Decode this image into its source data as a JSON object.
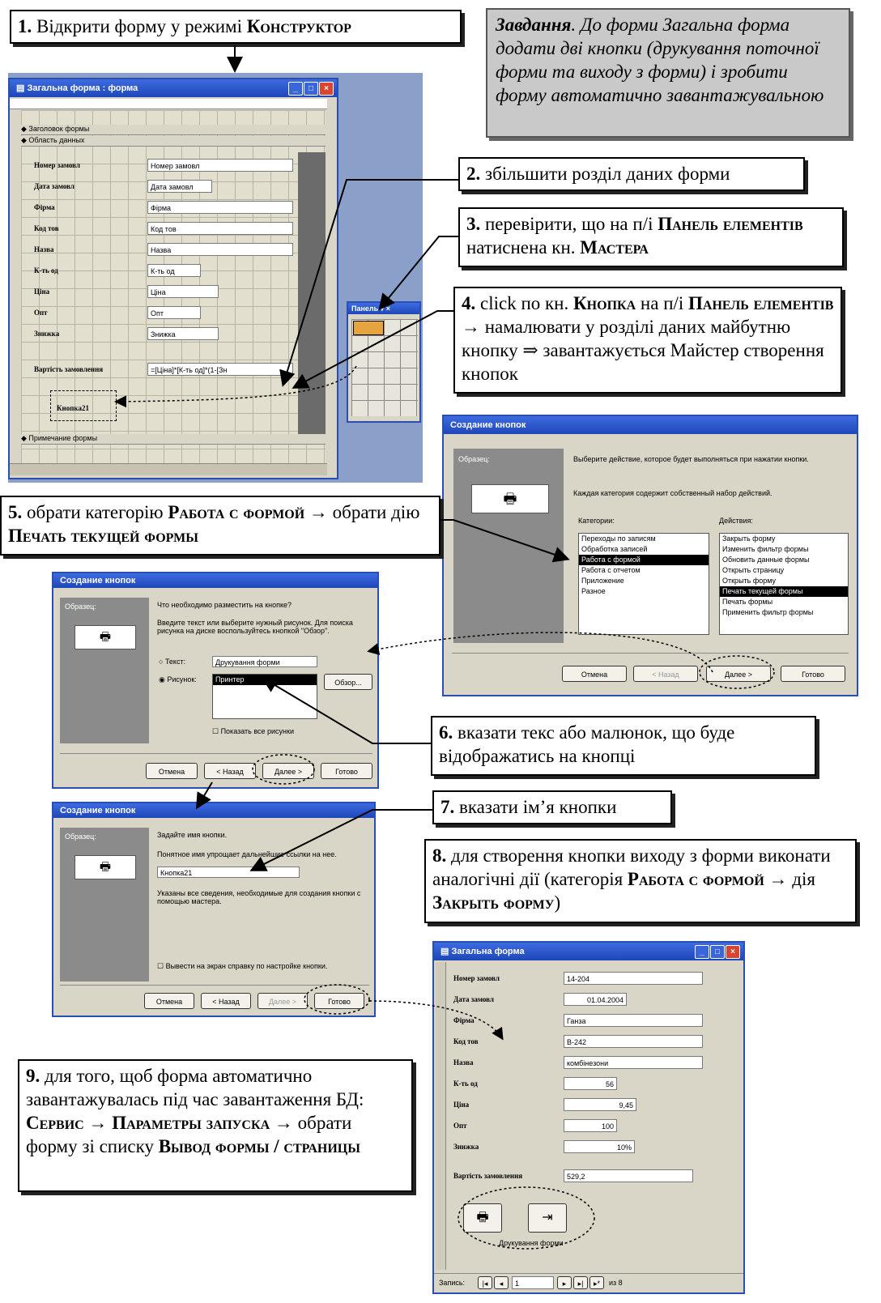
{
  "callouts": {
    "c1": {
      "num": "1.",
      "text": "Відкрити форму у режимі ",
      "bold": "Конструктор"
    },
    "task": {
      "lead": "Завдання",
      "text": ". До форми Загальна форма додати дві кнопки (друкування поточної форми та виходу з форми) і зробити форму автоматично завантажувальною"
    },
    "c2": {
      "num": "2.",
      "text": "збільшити розділ даних форми"
    },
    "c3": {
      "num": "3.",
      "text": "перевірити, що на п/і ",
      "b1": "Панель елементів",
      "t2": " натиснена кн. ",
      "b2": "Мастера"
    },
    "c4": {
      "num": "4.",
      "t1": "click по кн. ",
      "b1": "Кнопка",
      "t2": " на п/і ",
      "b2": "Панель елементів",
      "t3": " → намалювати у розділі даних майбутню кнопку ⇒ завантажується Майстер створення кнопок"
    },
    "c5": {
      "num": "5.",
      "t1": "обрати категорію ",
      "b1": "Работа с формой",
      "t2": " → обрати дію ",
      "b2": "Печать текущей формы"
    },
    "c6": {
      "num": "6.",
      "text": "вказати текс або малюнок, що буде відображатись на кнопці"
    },
    "c7": {
      "num": "7.",
      "text": "вказати ім’я кнопки"
    },
    "c8": {
      "num": "8.",
      "t1": "для створення кнопки виходу з форми виконати аналогічні дії (категорія ",
      "b1": "Работа с формой",
      "t2": " → дія ",
      "b2": "Закрыть форму",
      "t3": ")"
    },
    "c9": {
      "num": "9.",
      "t1": "для того, щоб форма автоматично завантажувалась під час завантаження БД: ",
      "b1": "Сервис → Параметры запуска",
      "t2": " → обрати форму зі списку ",
      "b2": "Вывод формы / страницы"
    }
  },
  "designer": {
    "title": "Загальна форма : форма",
    "header_section": "Заголовок формы",
    "data_section": "Область данных",
    "footer_section": "Примечание формы",
    "rows": [
      {
        "label": "Номер замовл",
        "field": "Номер замовл"
      },
      {
        "label": "Дата замовл",
        "field": "Дата замовл"
      },
      {
        "label": "Фірма",
        "field": "Фірма"
      },
      {
        "label": "Код тов",
        "field": "Код тов"
      },
      {
        "label": "Назва",
        "field": "Назва"
      },
      {
        "label": "К-ть од",
        "field": "К-ть од"
      },
      {
        "label": "Ціна",
        "field": "Ціна"
      },
      {
        "label": "Опт",
        "field": "Опт"
      },
      {
        "label": "Знижка",
        "field": "Знижка"
      },
      {
        "label": "Вартість замовлення",
        "field": "=[Ціна]*[К-ть од]*(1-[Зн"
      }
    ],
    "new_button": "Кнопка21"
  },
  "toolbox": {
    "title": "Панель"
  },
  "wizard1": {
    "title": "Создание кнопок",
    "sample": "Образец:",
    "prompt1": "Выберите действие, которое будет выполняться при нажатии кнопки.",
    "prompt2": "Каждая категория содержит собственный набор действий.",
    "cat_label": "Категории:",
    "act_label": "Действия:",
    "categories": [
      "Переходы по записям",
      "Обработка записей",
      "Работа с формой",
      "Работа с отчетом",
      "Приложение",
      "Разное"
    ],
    "actions": [
      "Закрыть форму",
      "Изменить фильтр формы",
      "Обновить данные формы",
      "Открыть страницу",
      "Открыть форму",
      "Печать текущей формы",
      "Печать формы",
      "Применить фильтр формы"
    ],
    "buttons": [
      "Отмена",
      "< Назад",
      "Далее >",
      "Готово"
    ]
  },
  "wizard2": {
    "title": "Создание кнопок",
    "sample": "Образец:",
    "prompt1": "Что необходимо разместить на кнопке?",
    "prompt2": "Введите текст или выберите нужный рисунок. Для поиска рисунка на диске воспользуйтесь кнопкой \"Обзор\".",
    "opt_text": "Текст:",
    "opt_text_value": "Друкування форми",
    "opt_pic": "Рисунок:",
    "pic_selected": "Принтер",
    "browse": "Обзор...",
    "show_all": "Показать все рисунки",
    "buttons": [
      "Отмена",
      "< Назад",
      "Далее >",
      "Готово"
    ]
  },
  "wizard3": {
    "title": "Создание кнопок",
    "sample": "Образец:",
    "prompt1": "Задайте имя кнопки.",
    "prompt2": "Понятное имя упрощает дальнейшие ссылки на нее.",
    "name_value": "Кнопка21",
    "prompt3": "Указаны все сведения, необходимые для создания кнопки с помощью мастера.",
    "help_check": "Вывести на экран справку по настройке кнопки.",
    "buttons": [
      "Отмена",
      "< Назад",
      "Далее >",
      "Готово"
    ]
  },
  "final": {
    "title": "Загальна форма",
    "rows": [
      {
        "label": "Номер замовл",
        "value": "14-204"
      },
      {
        "label": "Дата замовл",
        "value": "01.04.2004"
      },
      {
        "label": "Фірма",
        "value": "Ганза"
      },
      {
        "label": "Код тов",
        "value": "В-242"
      },
      {
        "label": "Назва",
        "value": "комбінезони"
      },
      {
        "label": "К-ть од",
        "value": "56"
      },
      {
        "label": "Ціна",
        "value": "9,45"
      },
      {
        "label": "Опт",
        "value": "100"
      },
      {
        "label": "Знижка",
        "value": "10%"
      }
    ],
    "total_label": "Вартість замовлення",
    "total_value": "529,2",
    "caption": "Друкування форми",
    "nav_label": "Запись:",
    "nav_value": "1",
    "nav_of": "из 8"
  }
}
